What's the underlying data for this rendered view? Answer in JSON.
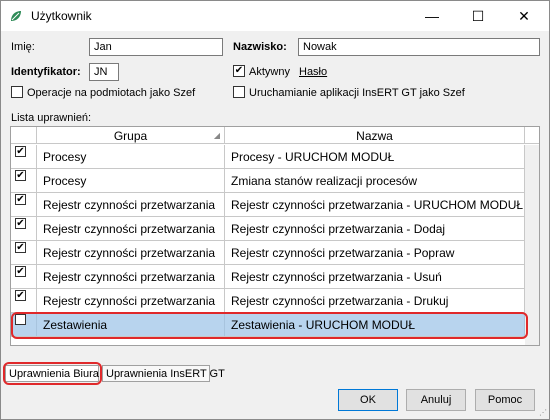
{
  "window": {
    "title": "Użytkownik",
    "min_glyph": "—",
    "max_glyph": "☐",
    "close_glyph": "✕"
  },
  "form": {
    "imie_label": "Imię:",
    "imie_value": "Jan",
    "nazwisko_label": "Nazwisko:",
    "nazwisko_value": "Nowak",
    "identyfikator_label": "Identyfikator:",
    "identyfikator_value": "JN",
    "aktywny_label": "Aktywny",
    "aktywny_checked": true,
    "haslo_link": "Hasło",
    "operacje_label": "Operacje na podmiotach jako Szef",
    "operacje_checked": false,
    "uruchamianie_label": "Uruchamianie aplikacji InsERT GT jako Szef",
    "uruchamianie_checked": false
  },
  "permissions": {
    "section_label": "Lista uprawnień:",
    "columns": [
      "Grupa",
      "Nazwa"
    ],
    "rows": [
      {
        "checked": true,
        "grupa": "Procesy",
        "nazwa": "Procesy - URUCHOM MODUŁ"
      },
      {
        "checked": true,
        "grupa": "Procesy",
        "nazwa": "Zmiana stanów realizacji procesów"
      },
      {
        "checked": true,
        "grupa": "Rejestr czynności przetwarzania",
        "nazwa": "Rejestr czynności przetwarzania - URUCHOM MODUŁ"
      },
      {
        "checked": true,
        "grupa": "Rejestr czynności przetwarzania",
        "nazwa": "Rejestr czynności przetwarzania - Dodaj"
      },
      {
        "checked": true,
        "grupa": "Rejestr czynności przetwarzania",
        "nazwa": "Rejestr czynności przetwarzania - Popraw"
      },
      {
        "checked": true,
        "grupa": "Rejestr czynności przetwarzania",
        "nazwa": "Rejestr czynności przetwarzania - Usuń"
      },
      {
        "checked": true,
        "grupa": "Rejestr czynności przetwarzania",
        "nazwa": "Rejestr czynności przetwarzania - Drukuj"
      },
      {
        "checked": false,
        "grupa": "Zestawienia",
        "nazwa": "Zestawienia - URUCHOM MODUŁ",
        "selected": true
      }
    ]
  },
  "tabs": [
    "Uprawnienia Biura GT",
    "Uprawnienia InsERT GT"
  ],
  "buttons": {
    "ok": "OK",
    "anuluj": "Anuluj",
    "pomoc": "Pomoc"
  },
  "colors": {
    "selection": "#b8d4ee",
    "highlight_outline": "#e0292b",
    "app_icon": "#2e8b57"
  }
}
